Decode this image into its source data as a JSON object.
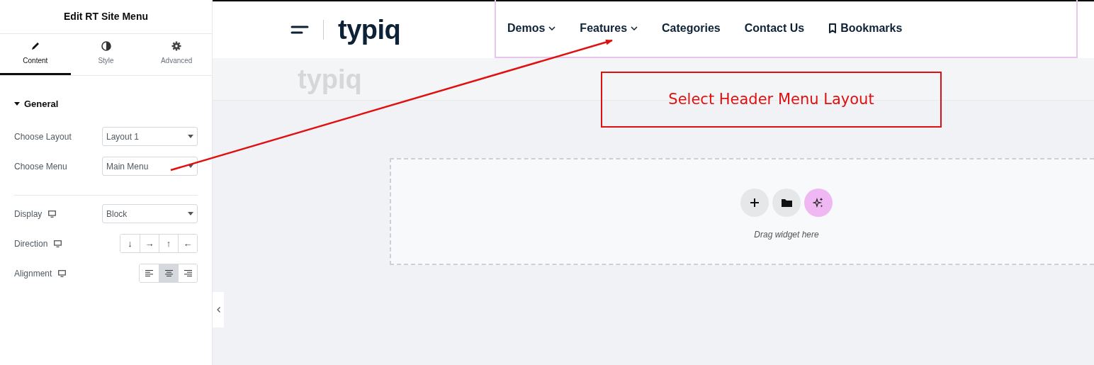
{
  "panel": {
    "title": "Edit RT Site Menu",
    "tabs": [
      {
        "label": "Content",
        "selected": true
      },
      {
        "label": "Style",
        "selected": false
      },
      {
        "label": "Advanced",
        "selected": false
      }
    ],
    "section": {
      "title": "General",
      "expanded": true
    },
    "controls": [
      {
        "kind": "select",
        "label": "Choose Layout",
        "value": "Layout 1"
      },
      {
        "kind": "select",
        "label": "Choose Menu",
        "value": "Main Menu"
      },
      {
        "kind": "divider"
      },
      {
        "kind": "select",
        "label": "Display",
        "responsive": true,
        "value": "Block"
      },
      {
        "kind": "arrows",
        "label": "Direction",
        "responsive": true,
        "options": [
          {
            "glyph": "↓",
            "selected": false
          },
          {
            "glyph": "→",
            "selected": false
          },
          {
            "glyph": "↑",
            "selected": false
          },
          {
            "glyph": "←",
            "selected": false
          }
        ]
      },
      {
        "kind": "align",
        "label": "Alignment",
        "responsive": true,
        "options": [
          {
            "selected": false
          },
          {
            "selected": true
          },
          {
            "selected": false
          }
        ]
      }
    ]
  },
  "header": {
    "logo": "typiq",
    "nav": [
      {
        "kind": "link",
        "label": "Demos",
        "dropdown": true
      },
      {
        "kind": "link",
        "label": "Features",
        "dropdown": true
      },
      {
        "kind": "link",
        "label": "Categories",
        "dropdown": false
      },
      {
        "kind": "link",
        "label": "Contact Us",
        "dropdown": false
      },
      {
        "kind": "bookmark",
        "label": "Bookmarks",
        "dropdown": false
      }
    ]
  },
  "faded_logo": "typiq",
  "annotation": "Select Header Menu Layout",
  "drop_zone": {
    "caption": "Drag widget here"
  }
}
